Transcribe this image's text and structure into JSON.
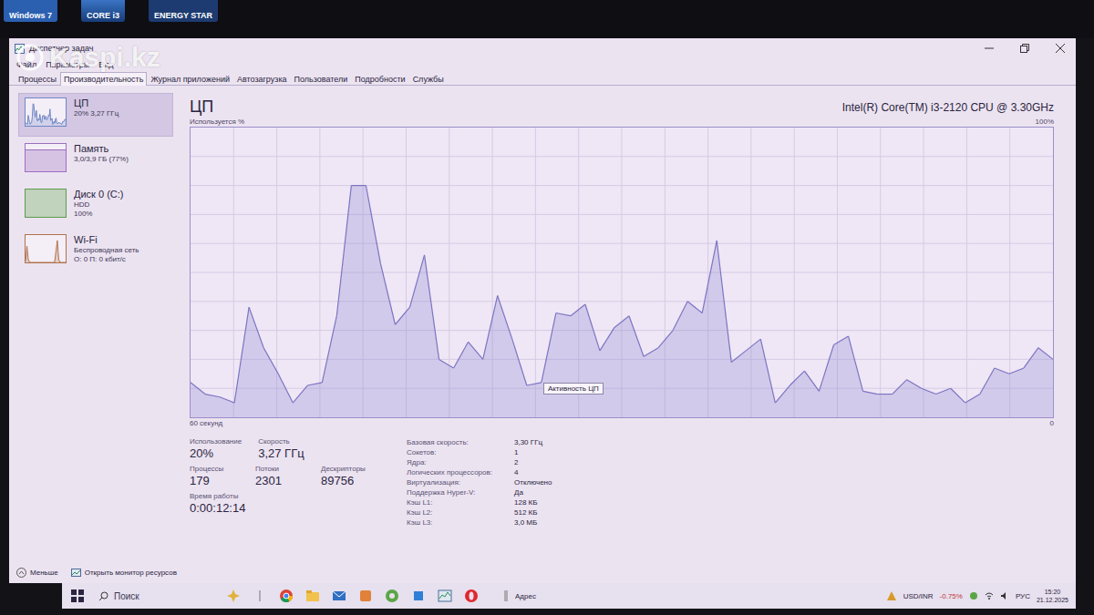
{
  "photo_frame": {
    "stickers": [
      "Windows 7",
      "CORE i3",
      "ENERGY STAR"
    ],
    "watermark": "Kaspi.kz"
  },
  "window": {
    "title": "Диспетчер задач"
  },
  "menu": [
    "Файл",
    "Параметры",
    "Вид"
  ],
  "tabs": [
    {
      "label": "Процессы",
      "selected": false
    },
    {
      "label": "Производительность",
      "selected": true
    },
    {
      "label": "Журнал приложений",
      "selected": false
    },
    {
      "label": "Автозагрузка",
      "selected": false
    },
    {
      "label": "Пользователи",
      "selected": false
    },
    {
      "label": "Подробности",
      "selected": false
    },
    {
      "label": "Службы",
      "selected": false
    }
  ],
  "sidebar": {
    "items": [
      {
        "title": "ЦП",
        "lines": [
          "20% 3,27 ГГц"
        ],
        "kind": "cpu",
        "color": "#6f86c6",
        "selected": true
      },
      {
        "title": "Память",
        "lines": [
          "3,0/3,9 ГБ (77%)"
        ],
        "kind": "memory",
        "color": "#9b6fc0",
        "level": 0.77,
        "selected": false
      },
      {
        "title": "Диск 0 (C:)",
        "lines": [
          "HDD",
          "100%"
        ],
        "kind": "disk",
        "color": "#5d9c4a",
        "level": 1,
        "selected": false
      },
      {
        "title": "Wi-Fi",
        "lines": [
          "Беспроводная сеть",
          "О: 0 П: 0 кбит/с"
        ],
        "kind": "network",
        "color": "#b0724a",
        "values": [
          5,
          60,
          10,
          0,
          0,
          0,
          0,
          0,
          0,
          0,
          0,
          0,
          0,
          0,
          0,
          0,
          0,
          0,
          0,
          0,
          0,
          0,
          40,
          80,
          10,
          0,
          0,
          0,
          0,
          0
        ],
        "selected": false
      }
    ]
  },
  "panel": {
    "title": "ЦП",
    "cpu_name": "Intel(R) Core(TM) i3-2120 CPU @ 3.30GHz",
    "y_label": "Используется %",
    "y_max": "100%",
    "x_label": "60 секунд",
    "y_min": "0",
    "tooltip": "Активность ЦП",
    "series": [
      12,
      8,
      7,
      5,
      38,
      24,
      15,
      5,
      11,
      12,
      35,
      80,
      80,
      53,
      32,
      38,
      56,
      20,
      17,
      26,
      20,
      42,
      27,
      11,
      12,
      36,
      35,
      39,
      23,
      31,
      35,
      21,
      24,
      30,
      40,
      36,
      61,
      19,
      23,
      27,
      5,
      11,
      16,
      9,
      25,
      28,
      9,
      8,
      8,
      13,
      10,
      8,
      10,
      5,
      8,
      17,
      15,
      17,
      24,
      20
    ]
  },
  "stats": [
    [
      {
        "label": "Использование",
        "value": "20%"
      },
      {
        "label": "Скорость",
        "value": "3,27 ГГц"
      }
    ],
    [
      {
        "label": "Процессы",
        "value": "179"
      },
      {
        "label": "Потоки",
        "value": "2301"
      },
      {
        "label": "Дескрипторы",
        "value": "89756"
      }
    ],
    [
      {
        "label": "Время работы",
        "value": "0:00:12:14"
      }
    ]
  ],
  "details": [
    {
      "label": "Базовая скорость:",
      "value": "3,30 ГГц"
    },
    {
      "label": "Сокетов:",
      "value": "1"
    },
    {
      "label": "Ядра:",
      "value": "2"
    },
    {
      "label": "Логических процессоров:",
      "value": "4"
    },
    {
      "label": "Виртуализация:",
      "value": "Отключено"
    },
    {
      "label": "Поддержка Hyper-V:",
      "value": "Да"
    },
    {
      "label": "Кэш L1:",
      "value": "128 КБ"
    },
    {
      "label": "Кэш L2:",
      "value": "512 КБ"
    },
    {
      "label": "Кэш L3:",
      "value": "3,0 МБ"
    }
  ],
  "footer": {
    "less": "Меньше",
    "monitor": "Открыть монитор ресурсов"
  },
  "taskbar": {
    "search": "Поиск",
    "address": "Адрес",
    "ticker": "USD/INR",
    "change": "-0.75%",
    "language": "РУС",
    "time": "15:20",
    "date": "21.12.2025"
  }
}
